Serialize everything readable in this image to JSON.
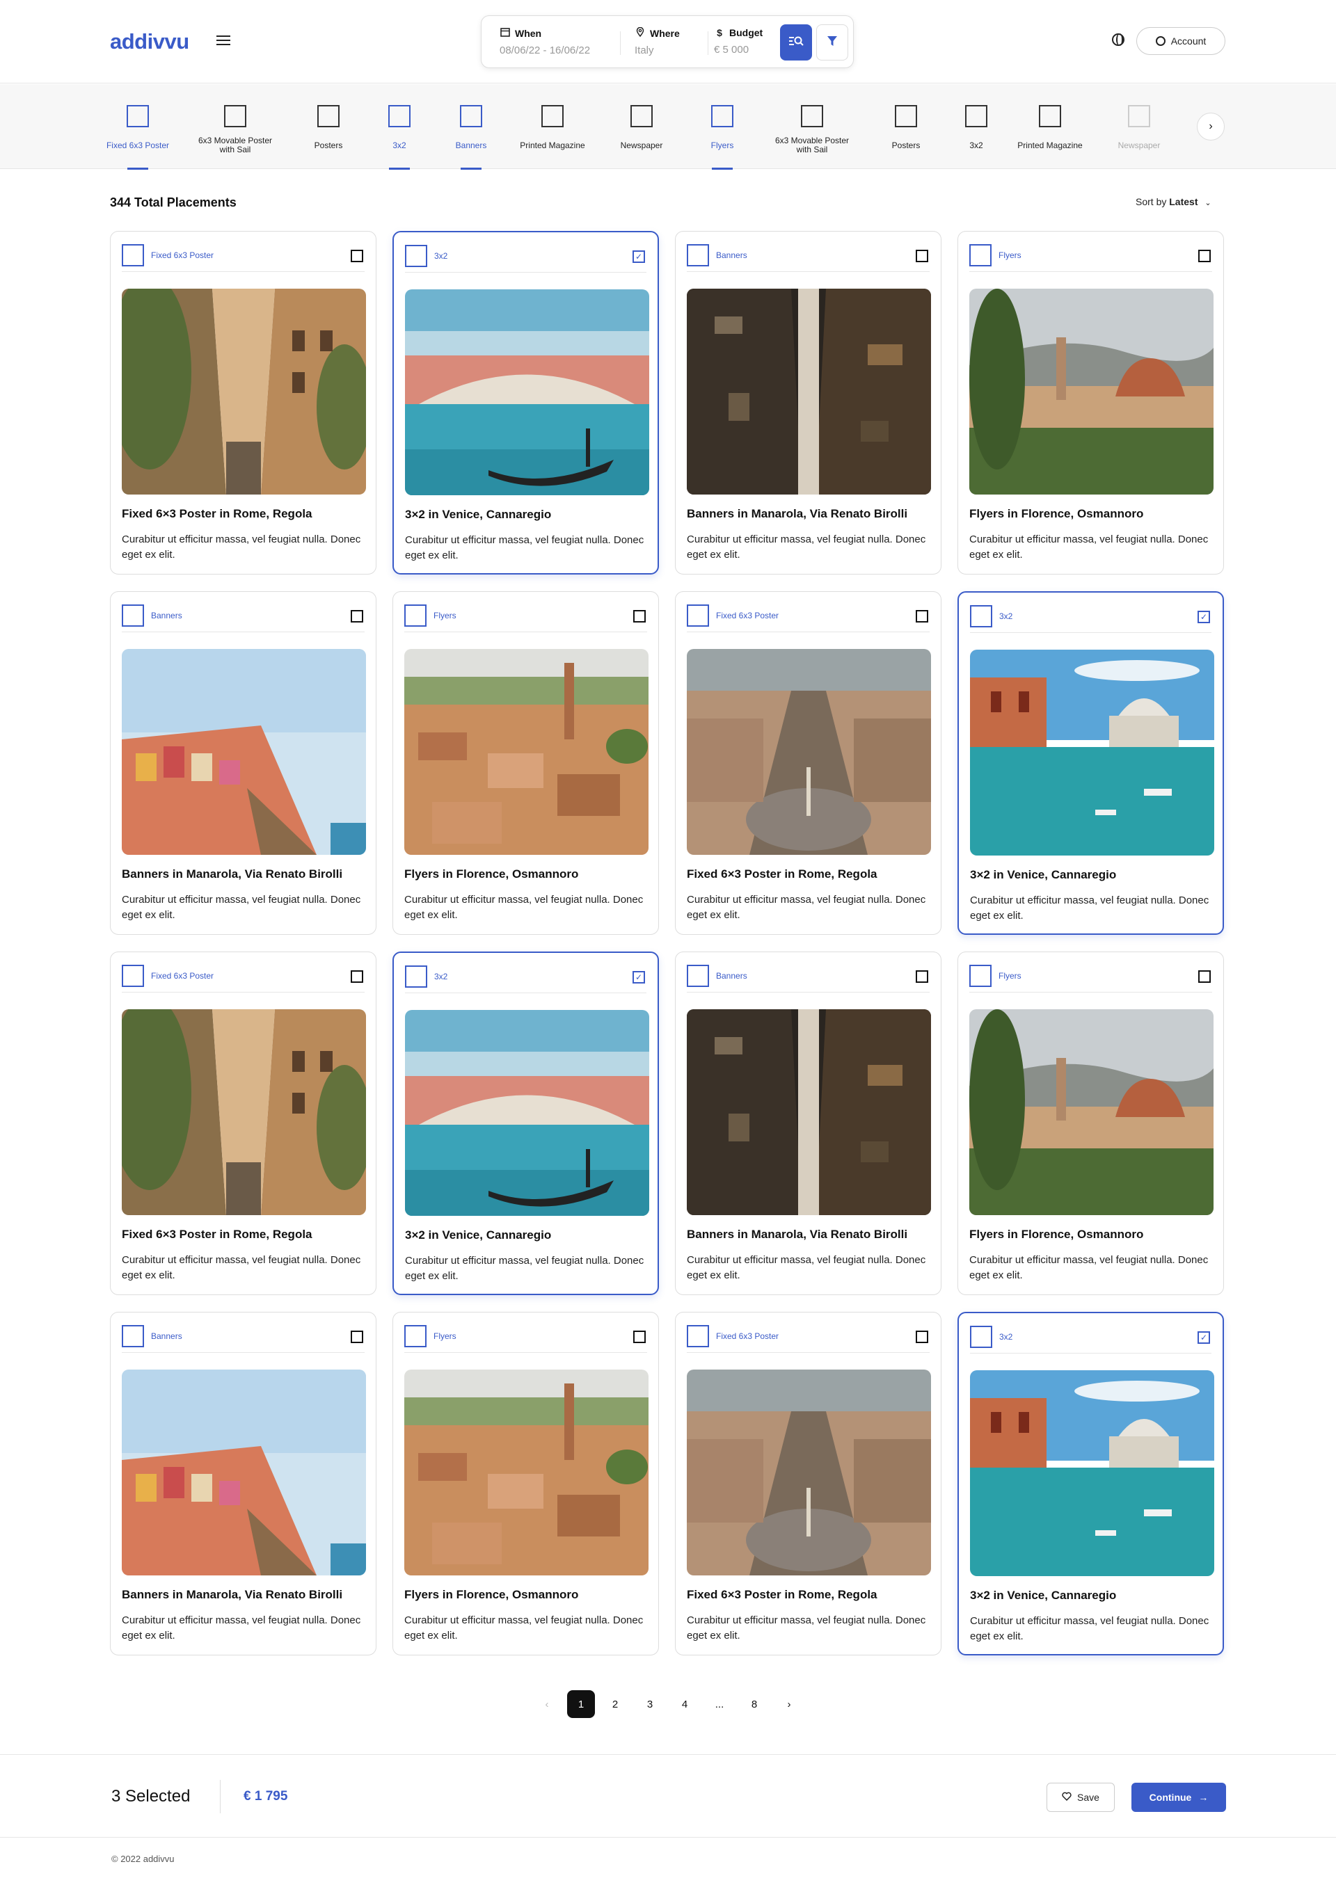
{
  "header": {
    "logo": "addivvu",
    "search": {
      "when_label": "When",
      "when_value": "08/06/22 - 16/06/22",
      "where_label": "Where",
      "where_value": "Italy",
      "budget_label": "Budget",
      "budget_value": "€ 5 000"
    },
    "account_label": "Account"
  },
  "categories": [
    {
      "label": "Fixed 6x3 Poster",
      "state": "active"
    },
    {
      "label": "6x3 Movable Poster with Sail",
      "state": "normal"
    },
    {
      "label": "Posters",
      "state": "normal"
    },
    {
      "label": "3x2",
      "state": "active"
    },
    {
      "label": "Banners",
      "state": "active"
    },
    {
      "label": "Printed Magazine",
      "state": "normal"
    },
    {
      "label": "Newspaper",
      "state": "normal"
    },
    {
      "label": "Flyers",
      "state": "active"
    },
    {
      "label": "6x3 Movable Poster with Sail",
      "state": "normal"
    },
    {
      "label": "Posters",
      "state": "normal"
    },
    {
      "label": "3x2",
      "state": "normal"
    },
    {
      "label": "Printed Magazine",
      "state": "normal"
    },
    {
      "label": "Newspaper",
      "state": "faded"
    }
  ],
  "listing": {
    "total": "344 Total Placements",
    "sort_prefix": "Sort by",
    "sort_value": "Latest"
  },
  "cards": [
    {
      "tag": "Fixed 6x3 Poster",
      "title": "Fixed 6×3 Poster in Rome, Regola",
      "desc": "Curabitur ut efficitur massa, vel feugiat nulla. Donec eget ex elit.",
      "selected": false,
      "image": "rome-street"
    },
    {
      "tag": "3x2",
      "title": "3×2 in Venice, Cannaregio",
      "desc": "Curabitur ut efficitur massa, vel feugiat nulla. Donec eget ex elit.",
      "selected": true,
      "image": "venice-rialto"
    },
    {
      "tag": "Banners",
      "title": "Banners in Manarola, Via Renato Birolli",
      "desc": "Curabitur ut efficitur massa, vel feugiat nulla. Donec eget ex elit.",
      "selected": false,
      "image": "narrow-alley"
    },
    {
      "tag": "Flyers",
      "title": "Flyers in Florence,  Osmannoro",
      "desc": "Curabitur ut efficitur massa, vel feugiat nulla. Donec eget ex elit.",
      "selected": false,
      "image": "florence-duomo"
    },
    {
      "tag": "Banners",
      "title": "Banners in Manarola, Via Renato Birolli",
      "desc": "Curabitur ut efficitur massa, vel feugiat nulla. Donec eget ex elit.",
      "selected": false,
      "image": "manarola-cliff"
    },
    {
      "tag": "Flyers",
      "title": "Flyers in Florence,  Osmannoro",
      "desc": "Curabitur ut efficitur massa, vel feugiat nulla. Donec eget ex elit.",
      "selected": false,
      "image": "siena-rooftops"
    },
    {
      "tag": "Fixed 6x3 Poster",
      "title": "Fixed 6×3 Poster in Rome, Regola",
      "desc": "Curabitur ut efficitur massa, vel feugiat nulla. Donec eget ex elit.",
      "selected": false,
      "image": "rome-aerial"
    },
    {
      "tag": "3x2",
      "title": "3×2 in Venice, Cannaregio",
      "desc": "Curabitur ut efficitur massa, vel feugiat nulla. Donec eget ex elit.",
      "selected": true,
      "image": "venice-canal"
    },
    {
      "tag": "Fixed 6x3 Poster",
      "title": "Fixed 6×3 Poster in Rome, Regola",
      "desc": "Curabitur ut efficitur massa, vel feugiat nulla. Donec eget ex elit.",
      "selected": false,
      "image": "rome-street"
    },
    {
      "tag": "3x2",
      "title": "3×2 in Venice, Cannaregio",
      "desc": "Curabitur ut efficitur massa, vel feugiat nulla. Donec eget ex elit.",
      "selected": true,
      "image": "venice-rialto"
    },
    {
      "tag": "Banners",
      "title": "Banners in Manarola, Via Renato Birolli",
      "desc": "Curabitur ut efficitur massa, vel feugiat nulla. Donec eget ex elit.",
      "selected": false,
      "image": "narrow-alley"
    },
    {
      "tag": "Flyers",
      "title": "Flyers in Florence,  Osmannoro",
      "desc": "Curabitur ut efficitur massa, vel feugiat nulla. Donec eget ex elit.",
      "selected": false,
      "image": "florence-duomo"
    },
    {
      "tag": "Banners",
      "title": "Banners in Manarola, Via Renato Birolli",
      "desc": "Curabitur ut efficitur massa, vel feugiat nulla. Donec eget ex elit.",
      "selected": false,
      "image": "manarola-cliff"
    },
    {
      "tag": "Flyers",
      "title": "Flyers in Florence,  Osmannoro",
      "desc": "Curabitur ut efficitur massa, vel feugiat nulla. Donec eget ex elit.",
      "selected": false,
      "image": "siena-rooftops"
    },
    {
      "tag": "Fixed 6x3 Poster",
      "title": "Fixed 6×3 Poster in Rome, Regola",
      "desc": "Curabitur ut efficitur massa, vel feugiat nulla. Donec eget ex elit.",
      "selected": false,
      "image": "rome-aerial"
    },
    {
      "tag": "3x2",
      "title": "3×2 in Venice, Cannaregio",
      "desc": "Curabitur ut efficitur massa, vel feugiat nulla. Donec eget ex elit.",
      "selected": true,
      "image": "venice-canal"
    }
  ],
  "pagination": {
    "pages": [
      "1",
      "2",
      "3",
      "4",
      "...",
      "8"
    ],
    "current": "1"
  },
  "footer": {
    "selected": "3 Selected",
    "price": "€ 1 795",
    "save_label": "Save",
    "continue_label": "Continue",
    "copyright": "© 2022 addivvu"
  },
  "colors": {
    "accent": "#3a5bc8"
  }
}
